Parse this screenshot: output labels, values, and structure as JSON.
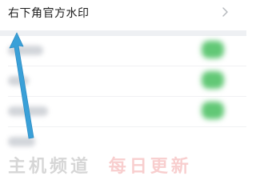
{
  "top_setting": {
    "label": "右下角官方水印",
    "chevron_icon": "chevron-right-icon"
  },
  "settings_list": {
    "items": [
      {
        "label_blurred": true,
        "toggle_on": true
      },
      {
        "label_blurred": true,
        "toggle_on": true
      },
      {
        "label_blurred": true,
        "toggle_on": true
      },
      {
        "label_blurred": true,
        "toggle_on": false
      }
    ]
  },
  "annotation": {
    "arrow_icon": "arrow-up-icon",
    "color": "#3aa0d8"
  },
  "colors": {
    "toggle_on": "#62c876",
    "separator": "#eef0f3"
  },
  "watermark": {
    "part1": "主机频道",
    "part2": "每日更新"
  }
}
